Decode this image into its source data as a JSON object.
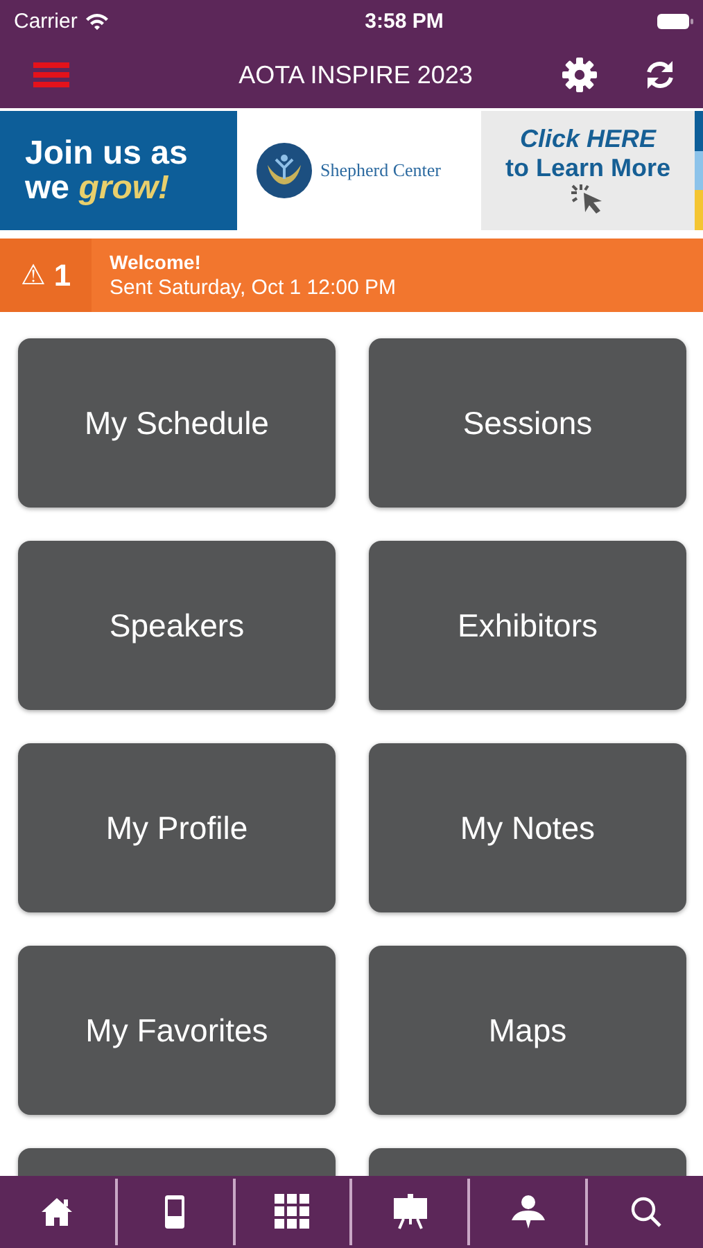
{
  "status_bar": {
    "carrier": "Carrier",
    "time": "3:58 PM"
  },
  "nav_bar": {
    "title": "AOTA INSPIRE 2023"
  },
  "banner": {
    "headline_start": "Join us as we ",
    "headline_accent": "grow!",
    "sponsor": "Shepherd Center",
    "cta_line_1": "Click HERE",
    "cta_line_2": "to Learn More"
  },
  "alert": {
    "icon": "⚠",
    "count": "1",
    "title": "Welcome!",
    "subtitle": "Sent Saturday, Oct 1 12:00 PM"
  },
  "tiles": [
    {
      "kind": "label",
      "label": "My Schedule"
    },
    {
      "kind": "label",
      "label": "Sessions"
    },
    {
      "kind": "label",
      "label": "Speakers"
    },
    {
      "kind": "label",
      "label": "Exhibitors"
    },
    {
      "kind": "label",
      "label": "My Profile"
    },
    {
      "kind": "label",
      "label": "My Notes"
    },
    {
      "kind": "label",
      "label": "My Favorites"
    },
    {
      "kind": "label",
      "label": "Maps"
    },
    {
      "kind": "blank"
    },
    {
      "kind": "blank"
    }
  ],
  "tab_bar": [
    {
      "kind": "home"
    },
    {
      "kind": "tablet"
    },
    {
      "kind": "grid"
    },
    {
      "kind": "easel"
    },
    {
      "kind": "person"
    },
    {
      "kind": "search"
    }
  ]
}
